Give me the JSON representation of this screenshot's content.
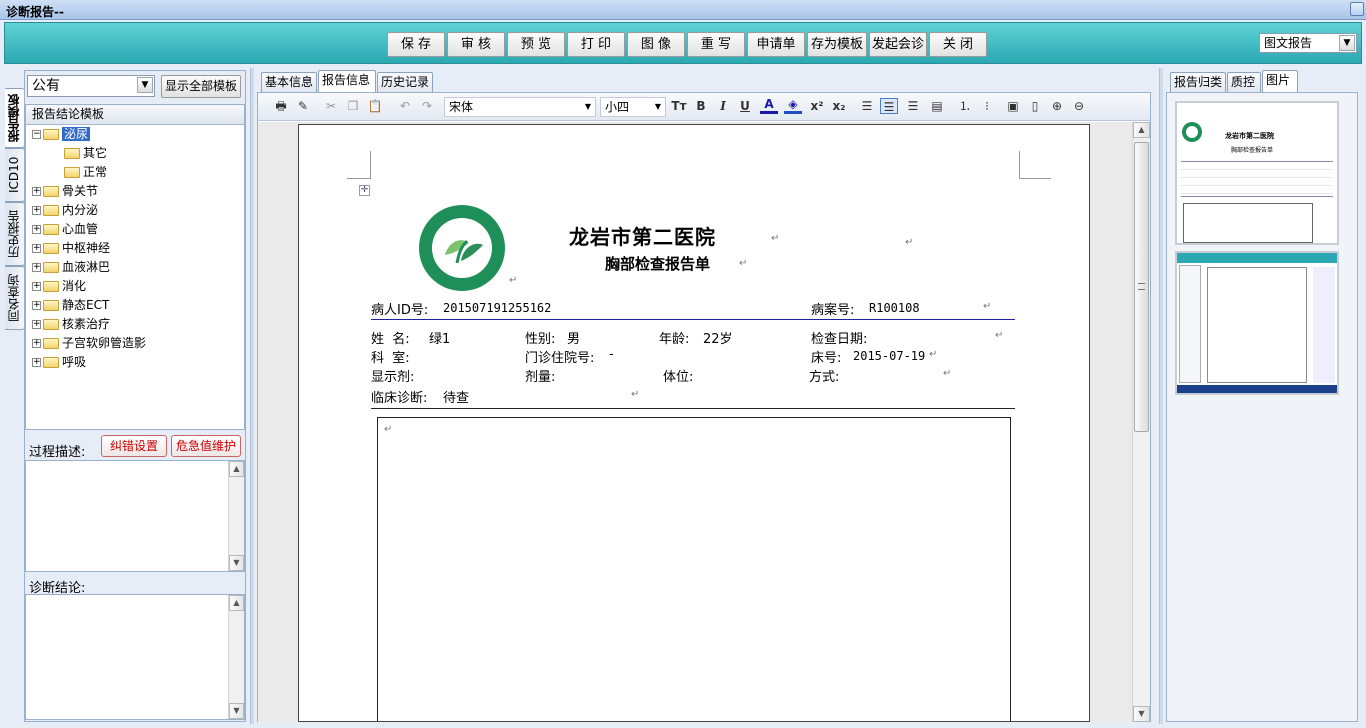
{
  "window": {
    "title": "诊断报告--"
  },
  "toolbar": {
    "buttons": [
      "保 存",
      "审 核",
      "预 览",
      "打 印",
      "图 像",
      "重 写",
      "申请单",
      "存为模板",
      "发起会诊",
      "关 闭"
    ],
    "report_type": "图文报告"
  },
  "left": {
    "vtabs": [
      "报告模板",
      "ICD10",
      "历史报告",
      "同名查询"
    ],
    "scope": "公有",
    "show_all": "显示全部模板",
    "tree_header": "报告结论模板",
    "tree": [
      {
        "label": "泌尿",
        "expanded": true,
        "selected": true,
        "children": [
          "其它",
          "正常"
        ]
      },
      {
        "label": "骨关节"
      },
      {
        "label": "内分泌"
      },
      {
        "label": "心血管"
      },
      {
        "label": "中枢神经"
      },
      {
        "label": "血液淋巴"
      },
      {
        "label": "消化"
      },
      {
        "label": "静态ECT"
      },
      {
        "label": "核素治疗"
      },
      {
        "label": "子宫软卵管造影"
      },
      {
        "label": "呼吸"
      }
    ],
    "process_label": "过程描述:",
    "error_btn": "纠错设置",
    "critical_btn": "危急值维护",
    "diagnosis_label": "诊断结论:"
  },
  "center": {
    "tabs": [
      "基本信息",
      "报告信息",
      "历史记录"
    ],
    "font_name": "宋体",
    "font_size": "小四",
    "toolbar_icons": [
      "print-icon",
      "format-painter-icon",
      "cut-icon",
      "copy-icon",
      "paste-icon",
      "undo-icon",
      "redo-icon",
      "font-size-icon",
      "bold-icon",
      "italic-icon",
      "underline-icon",
      "font-color-icon",
      "highlight-icon",
      "superscript-icon",
      "subscript-icon",
      "align-left-icon",
      "align-center-icon",
      "align-right-icon",
      "justify-icon",
      "numbered-list-icon",
      "bullet-list-icon",
      "insert-image-icon",
      "page-icon",
      "zoom-in-icon",
      "zoom-out-icon"
    ]
  },
  "report": {
    "hospital": "龙岩市第二医院",
    "title": "胸部检查报告单",
    "logo_text": "THE SECOND HOSPITAL OF LONGYAN",
    "id_label": "病人ID号:",
    "patient_id": "201507191255162",
    "case_label": "病案号:",
    "case_no": "R100108",
    "name_label": "姓  名:",
    "name": "绿1",
    "sex_label": "性别:",
    "sex": "男",
    "age_label": "年龄:",
    "age": "22岁",
    "date_label": "检查日期:",
    "dept_label": "科  室:",
    "clinic_label": "门诊住院号:",
    "clinic_no": "-",
    "bed_label": "床号:",
    "bed_date": "2015-07-19",
    "contrast_label": "显示剂:",
    "dose_label": "剂量:",
    "position_label": "体位:",
    "method_label": "方式:",
    "clinical_label": "临床诊断:",
    "clinical": "待查",
    "return_mark": "↵"
  },
  "right": {
    "tabs": [
      "报告归类",
      "质控",
      "图片"
    ],
    "thumb_hospital": "龙岩市第二医院",
    "thumb_title": "胸部检查报告单"
  }
}
